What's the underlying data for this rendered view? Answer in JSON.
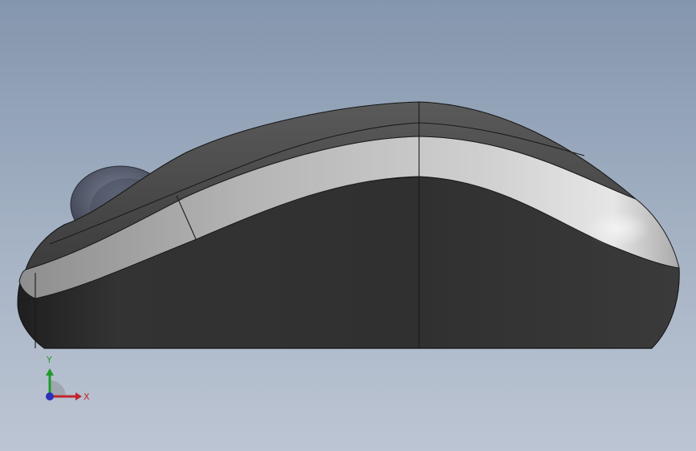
{
  "viewport": {
    "background_top": "#8496ad",
    "background_bottom": "#bcc5d3"
  },
  "model": {
    "object": "computer-mouse",
    "view": "side",
    "colors": {
      "body_dark": "#2f2f2f",
      "top_shell": "#4b4b4b",
      "silver_band": "#bdbdbd",
      "wheel": "#5b6272"
    }
  },
  "triad": {
    "x_label": "X",
    "y_label": "Y",
    "x_color": "#c0262c",
    "y_color": "#1f9b2a",
    "z_color": "#2b2fb8"
  }
}
